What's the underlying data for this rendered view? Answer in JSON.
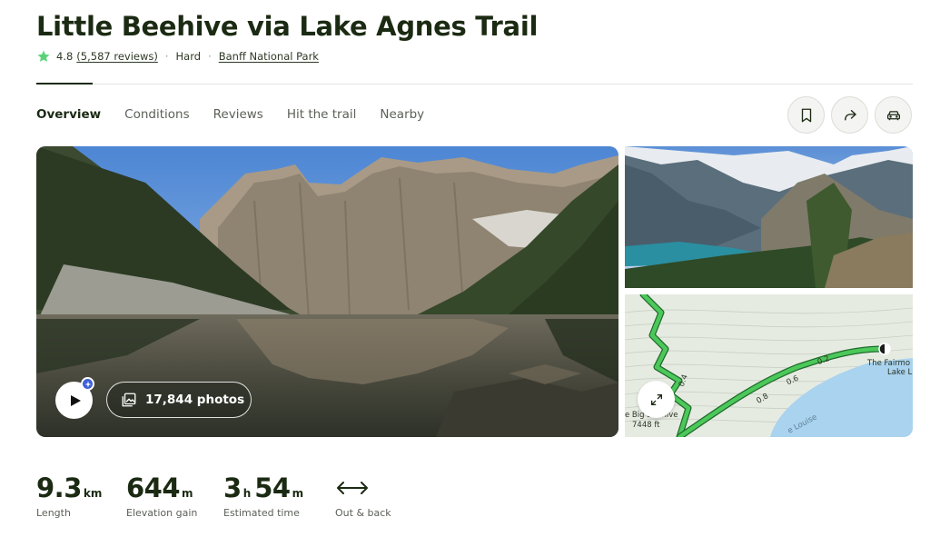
{
  "header": {
    "title": "Little Beehive via Lake Agnes Trail",
    "rating": "4.8",
    "reviews": "(5,587 reviews)",
    "difficulty": "Hard",
    "park": "Banff National Park",
    "star_color": "#5bd27a"
  },
  "tabs": [
    {
      "label": "Overview"
    },
    {
      "label": "Conditions"
    },
    {
      "label": "Reviews"
    },
    {
      "label": "Hit the trail"
    },
    {
      "label": "Nearby"
    }
  ],
  "actions": [
    "bookmark-icon",
    "share-icon",
    "car-icon"
  ],
  "gallery": {
    "photos_count": "17,844 photos"
  },
  "map": {
    "label_beehive": "e Big Beehive",
    "label_elev": "7448 ft",
    "label_hotel_1": "The Fairmo",
    "label_hotel_2": "Lake L",
    "label_lake": "e Louise",
    "label_km_1": "0.2",
    "label_km_2": "0.4",
    "label_km_3": "0.6",
    "label_km_4": "0.8",
    "trail_color": "#4cc85a"
  },
  "stats": {
    "length": {
      "value": "9.3",
      "unit": "km",
      "label": "Length"
    },
    "elevation": {
      "value": "644",
      "unit": "m",
      "label": "Elevation gain"
    },
    "time": {
      "hours": "3",
      "h_unit": "h",
      "minutes": "54",
      "m_unit": "m",
      "label": "Estimated time"
    },
    "route": {
      "label": "Out & back",
      "icon": "double-arrow-icon"
    }
  }
}
